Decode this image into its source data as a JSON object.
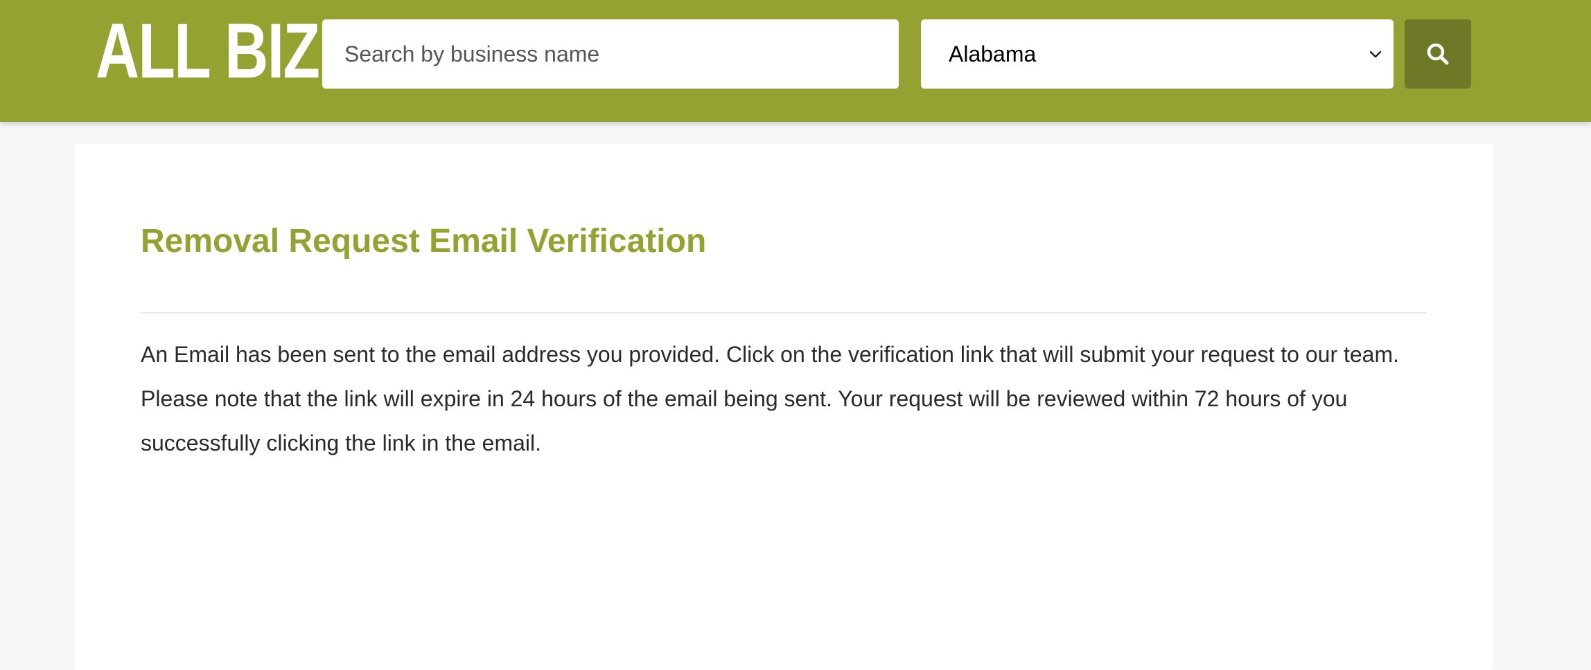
{
  "header": {
    "logo_text": "ALL BIZ",
    "search": {
      "placeholder": "Search by business name",
      "value": ""
    },
    "state_select": {
      "selected": "Alabama"
    },
    "search_button_icon": "search-icon"
  },
  "main": {
    "title": "Removal Request Email Verification",
    "message": "An Email has been sent to the email address you provided. Click on the verification link that will submit your request to our team. Please note that the link will expire in 24 hours of the email being sent. Your request will be reviewed within 72 hours of you successfully clicking the link in the email."
  },
  "colors": {
    "brand": "#95a232",
    "brand_dark": "#6e7826",
    "page_background": "#f7f7f7"
  }
}
